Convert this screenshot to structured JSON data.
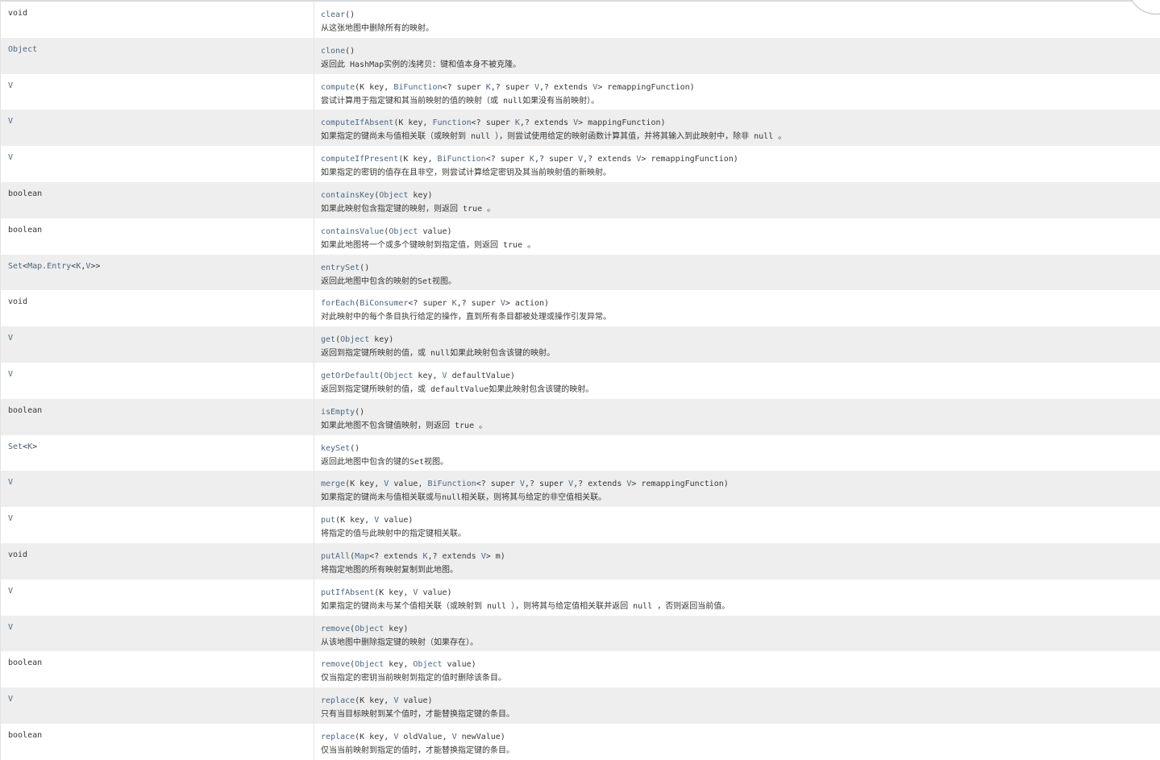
{
  "rows": [
    {
      "type": [
        {
          "t": "void",
          "k": "kw"
        }
      ],
      "sig": [
        {
          "t": "clear",
          "k": "m"
        },
        {
          "t": "()",
          "k": "kw"
        }
      ],
      "desc": "从这张地图中删除所有的映射。"
    },
    {
      "type": [
        {
          "t": "Object",
          "k": "link"
        }
      ],
      "sig": [
        {
          "t": "clone",
          "k": "m"
        },
        {
          "t": "()",
          "k": "kw"
        }
      ],
      "desc": "返回此 HashMap实例的浅拷贝：键和值本身不被克隆。"
    },
    {
      "type": [
        {
          "t": "V",
          "k": "link"
        }
      ],
      "sig": [
        {
          "t": "compute",
          "k": "m"
        },
        {
          "t": "(K key, ",
          "k": "kw"
        },
        {
          "t": "BiFunction",
          "k": "link"
        },
        {
          "t": "<? super ",
          "k": "kw"
        },
        {
          "t": "K",
          "k": "link"
        },
        {
          "t": ",? super ",
          "k": "kw"
        },
        {
          "t": "V",
          "k": "link"
        },
        {
          "t": ",? extends ",
          "k": "kw"
        },
        {
          "t": "V",
          "k": "link"
        },
        {
          "t": "> remappingFunction)",
          "k": "kw"
        }
      ],
      "desc": "尝试计算用于指定键和其当前映射的值的映射（或 null如果没有当前映射）。"
    },
    {
      "type": [
        {
          "t": "V",
          "k": "link"
        }
      ],
      "sig": [
        {
          "t": "computeIfAbsent",
          "k": "m"
        },
        {
          "t": "(K key, ",
          "k": "kw"
        },
        {
          "t": "Function",
          "k": "link"
        },
        {
          "t": "<? super ",
          "k": "kw"
        },
        {
          "t": "K",
          "k": "link"
        },
        {
          "t": ",? extends ",
          "k": "kw"
        },
        {
          "t": "V",
          "k": "link"
        },
        {
          "t": "> mappingFunction)",
          "k": "kw"
        }
      ],
      "desc": "如果指定的键尚未与值相关联（或映射到 null ），则尝试使用给定的映射函数计算其值，并将其输入到此映射中，除非 null 。"
    },
    {
      "type": [
        {
          "t": "V",
          "k": "link"
        }
      ],
      "sig": [
        {
          "t": "computeIfPresent",
          "k": "m"
        },
        {
          "t": "(K key, ",
          "k": "kw"
        },
        {
          "t": "BiFunction",
          "k": "link"
        },
        {
          "t": "<? super ",
          "k": "kw"
        },
        {
          "t": "K",
          "k": "link"
        },
        {
          "t": ",? super ",
          "k": "kw"
        },
        {
          "t": "V",
          "k": "link"
        },
        {
          "t": ",? extends ",
          "k": "kw"
        },
        {
          "t": "V",
          "k": "link"
        },
        {
          "t": "> remappingFunction)",
          "k": "kw"
        }
      ],
      "desc": "如果指定的密钥的值存在且非空，则尝试计算给定密钥及其当前映射值的新映射。"
    },
    {
      "type": [
        {
          "t": "boolean",
          "k": "kw"
        }
      ],
      "sig": [
        {
          "t": "containsKey",
          "k": "m"
        },
        {
          "t": "(",
          "k": "kw"
        },
        {
          "t": "Object",
          "k": "link"
        },
        {
          "t": " key)",
          "k": "kw"
        }
      ],
      "desc": "如果此映射包含指定键的映射，则返回 true 。"
    },
    {
      "type": [
        {
          "t": "boolean",
          "k": "kw"
        }
      ],
      "sig": [
        {
          "t": "containsValue",
          "k": "m"
        },
        {
          "t": "(",
          "k": "kw"
        },
        {
          "t": "Object",
          "k": "link"
        },
        {
          "t": " value)",
          "k": "kw"
        }
      ],
      "desc": "如果此地图将一个或多个键映射到指定值，则返回 true 。"
    },
    {
      "type": [
        {
          "t": "Set",
          "k": "link"
        },
        {
          "t": "<",
          "k": "kw"
        },
        {
          "t": "Map.Entry",
          "k": "link"
        },
        {
          "t": "<",
          "k": "kw"
        },
        {
          "t": "K",
          "k": "link"
        },
        {
          "t": ",",
          "k": "kw"
        },
        {
          "t": "V",
          "k": "link"
        },
        {
          "t": ">>",
          "k": "kw"
        }
      ],
      "sig": [
        {
          "t": "entrySet",
          "k": "m"
        },
        {
          "t": "()",
          "k": "kw"
        }
      ],
      "desc": "返回此地图中包含的映射的Set视图。"
    },
    {
      "type": [
        {
          "t": "void",
          "k": "kw"
        }
      ],
      "sig": [
        {
          "t": "forEach",
          "k": "m"
        },
        {
          "t": "(",
          "k": "kw"
        },
        {
          "t": "BiConsumer",
          "k": "link"
        },
        {
          "t": "<? super ",
          "k": "kw"
        },
        {
          "t": "K",
          "k": "link"
        },
        {
          "t": ",? super ",
          "k": "kw"
        },
        {
          "t": "V",
          "k": "link"
        },
        {
          "t": "> action)",
          "k": "kw"
        }
      ],
      "desc": "对此映射中的每个条目执行给定的操作，直到所有条目都被处理或操作引发异常。"
    },
    {
      "type": [
        {
          "t": "V",
          "k": "link"
        }
      ],
      "sig": [
        {
          "t": "get",
          "k": "m"
        },
        {
          "t": "(",
          "k": "kw"
        },
        {
          "t": "Object",
          "k": "link"
        },
        {
          "t": " key)",
          "k": "kw"
        }
      ],
      "desc": "返回到指定键所映射的值，或 null如果此映射包含该键的映射。"
    },
    {
      "type": [
        {
          "t": "V",
          "k": "link"
        }
      ],
      "sig": [
        {
          "t": "getOrDefault",
          "k": "m"
        },
        {
          "t": "(",
          "k": "kw"
        },
        {
          "t": "Object",
          "k": "link"
        },
        {
          "t": " key, ",
          "k": "kw"
        },
        {
          "t": "V",
          "k": "link"
        },
        {
          "t": " defaultValue)",
          "k": "kw"
        }
      ],
      "desc": "返回到指定键所映射的值，或 defaultValue如果此映射包含该键的映射。"
    },
    {
      "type": [
        {
          "t": "boolean",
          "k": "kw"
        }
      ],
      "sig": [
        {
          "t": "isEmpty",
          "k": "m"
        },
        {
          "t": "()",
          "k": "kw"
        }
      ],
      "desc": "如果此地图不包含键值映射，则返回 true 。"
    },
    {
      "type": [
        {
          "t": "Set",
          "k": "link"
        },
        {
          "t": "<",
          "k": "kw"
        },
        {
          "t": "K",
          "k": "link"
        },
        {
          "t": ">",
          "k": "kw"
        }
      ],
      "sig": [
        {
          "t": "keySet",
          "k": "m"
        },
        {
          "t": "()",
          "k": "kw"
        }
      ],
      "desc": "返回此地图中包含的键的Set视图。"
    },
    {
      "type": [
        {
          "t": "V",
          "k": "link"
        }
      ],
      "sig": [
        {
          "t": "merge",
          "k": "m"
        },
        {
          "t": "(K key, ",
          "k": "kw"
        },
        {
          "t": "V",
          "k": "link"
        },
        {
          "t": " value, ",
          "k": "kw"
        },
        {
          "t": "BiFunction",
          "k": "link"
        },
        {
          "t": "<? super ",
          "k": "kw"
        },
        {
          "t": "V",
          "k": "link"
        },
        {
          "t": ",? super ",
          "k": "kw"
        },
        {
          "t": "V",
          "k": "link"
        },
        {
          "t": ",? extends ",
          "k": "kw"
        },
        {
          "t": "V",
          "k": "link"
        },
        {
          "t": "> remappingFunction)",
          "k": "kw"
        }
      ],
      "desc": "如果指定的键尚未与值相关联或与null相关联，则将其与给定的非空值相关联。"
    },
    {
      "type": [
        {
          "t": "V",
          "k": "link"
        }
      ],
      "sig": [
        {
          "t": "put",
          "k": "m"
        },
        {
          "t": "(K key, ",
          "k": "kw"
        },
        {
          "t": "V",
          "k": "link"
        },
        {
          "t": " value)",
          "k": "kw"
        }
      ],
      "desc": "将指定的值与此映射中的指定键相关联。"
    },
    {
      "type": [
        {
          "t": "void",
          "k": "kw"
        }
      ],
      "sig": [
        {
          "t": "putAll",
          "k": "m"
        },
        {
          "t": "(",
          "k": "kw"
        },
        {
          "t": "Map",
          "k": "link"
        },
        {
          "t": "<? extends ",
          "k": "kw"
        },
        {
          "t": "K",
          "k": "link"
        },
        {
          "t": ",? extends ",
          "k": "kw"
        },
        {
          "t": "V",
          "k": "link"
        },
        {
          "t": "> m)",
          "k": "kw"
        }
      ],
      "desc": "将指定地图的所有映射复制到此地图。"
    },
    {
      "type": [
        {
          "t": "V",
          "k": "link"
        }
      ],
      "sig": [
        {
          "t": "putIfAbsent",
          "k": "m"
        },
        {
          "t": "(K key, ",
          "k": "kw"
        },
        {
          "t": "V",
          "k": "link"
        },
        {
          "t": " value)",
          "k": "kw"
        }
      ],
      "desc": "如果指定的键尚未与某个值相关联（或映射到 null ），则将其与给定值相关联并返回 null ，否则返回当前值。"
    },
    {
      "type": [
        {
          "t": "V",
          "k": "link"
        }
      ],
      "sig": [
        {
          "t": "remove",
          "k": "m"
        },
        {
          "t": "(",
          "k": "kw"
        },
        {
          "t": "Object",
          "k": "link"
        },
        {
          "t": " key)",
          "k": "kw"
        }
      ],
      "desc": "从该地图中删除指定键的映射（如果存在）。"
    },
    {
      "type": [
        {
          "t": "boolean",
          "k": "kw"
        }
      ],
      "sig": [
        {
          "t": "remove",
          "k": "m"
        },
        {
          "t": "(",
          "k": "kw"
        },
        {
          "t": "Object",
          "k": "link"
        },
        {
          "t": " key, ",
          "k": "kw"
        },
        {
          "t": "Object",
          "k": "link"
        },
        {
          "t": " value)",
          "k": "kw"
        }
      ],
      "desc": "仅当指定的密钥当前映射到指定的值时删除该条目。"
    },
    {
      "type": [
        {
          "t": "V",
          "k": "link"
        }
      ],
      "sig": [
        {
          "t": "replace",
          "k": "m"
        },
        {
          "t": "(K key, ",
          "k": "kw"
        },
        {
          "t": "V",
          "k": "link"
        },
        {
          "t": " value)",
          "k": "kw"
        }
      ],
      "desc": "只有当目标映射到某个值时，才能替换指定键的条目。"
    },
    {
      "type": [
        {
          "t": "boolean",
          "k": "kw"
        }
      ],
      "sig": [
        {
          "t": "replace",
          "k": "m"
        },
        {
          "t": "(K key, ",
          "k": "kw"
        },
        {
          "t": "V",
          "k": "link"
        },
        {
          "t": " oldValue, ",
          "k": "kw"
        },
        {
          "t": "V",
          "k": "link"
        },
        {
          "t": " newValue)",
          "k": "kw"
        }
      ],
      "desc": "仅当当前映射到指定的值时，才能替换指定键的条目。"
    }
  ],
  "colors": {
    "link": "#4a6782",
    "text": "#353833",
    "alt_row": "#eeeeef"
  }
}
